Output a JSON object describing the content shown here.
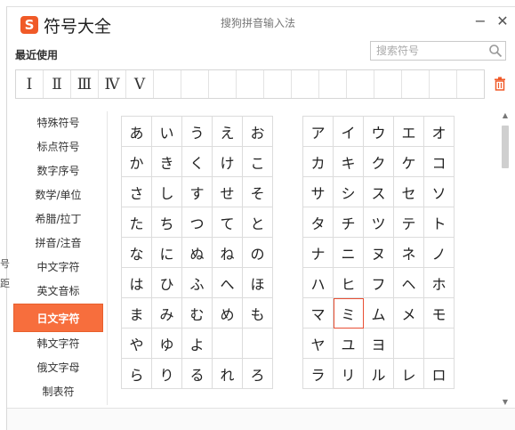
{
  "window": {
    "logo": "S",
    "title": "符号大全",
    "subtitle": "搜狗拼音输入法",
    "minimize": "−",
    "close": "✕"
  },
  "recent": {
    "label": "最近使用",
    "items": [
      "Ⅰ",
      "Ⅱ",
      "Ⅲ",
      "Ⅳ",
      "Ⅴ",
      "",
      "",
      "",
      "",
      "",
      "",
      "",
      "",
      "",
      "",
      "",
      ""
    ]
  },
  "search": {
    "placeholder": "搜索符号"
  },
  "edge_chars": [
    "号",
    "距"
  ],
  "categories": [
    "特殊符号",
    "标点符号",
    "数字序号",
    "数学/单位",
    "希腊/拉丁",
    "拼音/注音",
    "中文字符",
    "英文音标",
    "日文字符",
    "韩文字符",
    "俄文字母",
    "制表符"
  ],
  "hiragana": [
    [
      "あ",
      "い",
      "う",
      "え",
      "お"
    ],
    [
      "か",
      "き",
      "く",
      "け",
      "こ"
    ],
    [
      "さ",
      "し",
      "す",
      "せ",
      "そ"
    ],
    [
      "た",
      "ち",
      "つ",
      "て",
      "と"
    ],
    [
      "な",
      "に",
      "ぬ",
      "ね",
      "の"
    ],
    [
      "は",
      "ひ",
      "ふ",
      "へ",
      "ほ"
    ],
    [
      "ま",
      "み",
      "む",
      "め",
      "も"
    ],
    [
      "や",
      "ゆ",
      "よ",
      "",
      ""
    ],
    [
      "ら",
      "り",
      "る",
      "れ",
      "ろ"
    ]
  ],
  "katakana": [
    [
      "ア",
      "イ",
      "ウ",
      "エ",
      "オ"
    ],
    [
      "カ",
      "キ",
      "ク",
      "ケ",
      "コ"
    ],
    [
      "サ",
      "シ",
      "ス",
      "セ",
      "ソ"
    ],
    [
      "タ",
      "チ",
      "ツ",
      "テ",
      "ト"
    ],
    [
      "ナ",
      "ニ",
      "ヌ",
      "ネ",
      "ノ"
    ],
    [
      "ハ",
      "ヒ",
      "フ",
      "ヘ",
      "ホ"
    ],
    [
      "マ",
      "ミ",
      "ム",
      "メ",
      "モ"
    ],
    [
      "ヤ",
      "ユ",
      "ヨ",
      "",
      ""
    ],
    [
      "ラ",
      "リ",
      "ル",
      "レ",
      "ロ"
    ]
  ],
  "selected_category": "日文字符",
  "selected_symbol": "ミ",
  "colors": {
    "accent": "#f76e3d",
    "selected_border": "#e84f34"
  }
}
